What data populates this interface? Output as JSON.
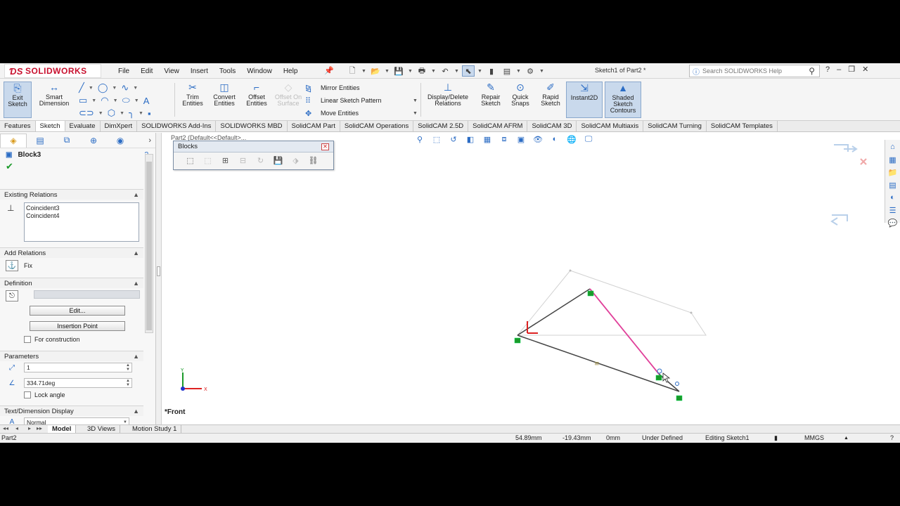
{
  "app": {
    "name": "SOLIDWORKS",
    "doc_title": "Sketch1 of Part2 *"
  },
  "menu": [
    "File",
    "Edit",
    "View",
    "Insert",
    "Tools",
    "Window",
    "Help"
  ],
  "search": {
    "placeholder": "Search SOLIDWORKS Help"
  },
  "window_controls": [
    "?",
    "–",
    "❐",
    "✕"
  ],
  "commands": {
    "exit_sketch": "Exit Sketch",
    "smart_dimension": "Smart Dimension",
    "trim_entities": "Trim Entities",
    "convert_entities": "Convert Entities",
    "offset_entities": "Offset Entities",
    "offset_on_surface": "Offset On Surface",
    "mirror_entities": "Mirror Entities",
    "linear_sketch_pattern": "Linear Sketch Pattern",
    "move_entities": "Move Entities",
    "display_delete_relations": "Display/Delete Relations",
    "repair_sketch": "Repair Sketch",
    "quick_snaps": "Quick Snaps",
    "rapid_sketch": "Rapid Sketch",
    "instant2d": "Instant2D",
    "shaded_sketch_contours": "Shaded Sketch Contours"
  },
  "tabs": [
    "Features",
    "Sketch",
    "Evaluate",
    "DimXpert",
    "SOLIDWORKS Add-Ins",
    "SOLIDWORKS MBD",
    "SolidCAM Part",
    "SolidCAM Operations",
    "SolidCAM 2.5D",
    "SolidCAM AFRM",
    "SolidCAM 3D",
    "SolidCAM Multiaxis",
    "SolidCAM Turning",
    "SolidCAM Templates"
  ],
  "active_tab": "Sketch",
  "property_manager": {
    "title": "Block3",
    "existing_relations": {
      "header": "Existing Relations",
      "items": [
        "Coincident3",
        "Coincident4"
      ]
    },
    "add_relations": {
      "header": "Add Relations",
      "fix_label": "Fix"
    },
    "definition": {
      "header": "Definition",
      "edit_button": "Edit...",
      "insertion_point_button": "Insertion Point",
      "for_construction": "For construction"
    },
    "parameters": {
      "header": "Parameters",
      "scale": "1",
      "angle": "334.71deg",
      "lock_angle": "Lock angle"
    },
    "text_display": {
      "header": "Text/Dimension Display",
      "value": "Normal"
    }
  },
  "graphics": {
    "breadcrumb": "Part2 (Default<<Default>...",
    "blocks_toolbar_title": "Blocks",
    "view_orientation": "*Front",
    "triad": {
      "x": "X",
      "y": "Y"
    }
  },
  "bottom_tabs": [
    "Model",
    "3D Views",
    "Motion Study 1"
  ],
  "active_bottom_tab": "Model",
  "status": {
    "doc": "Part2",
    "x": "54.89mm",
    "y": "-19.43mm",
    "z": "0mm",
    "state": "Under Defined",
    "editing": "Editing Sketch1",
    "units": "MMGS"
  },
  "colors": {
    "brand": "#c8102e",
    "accent": "#2b6cc4",
    "selected_line": "#e0409a",
    "fixed_point": "#1b9a2a"
  }
}
